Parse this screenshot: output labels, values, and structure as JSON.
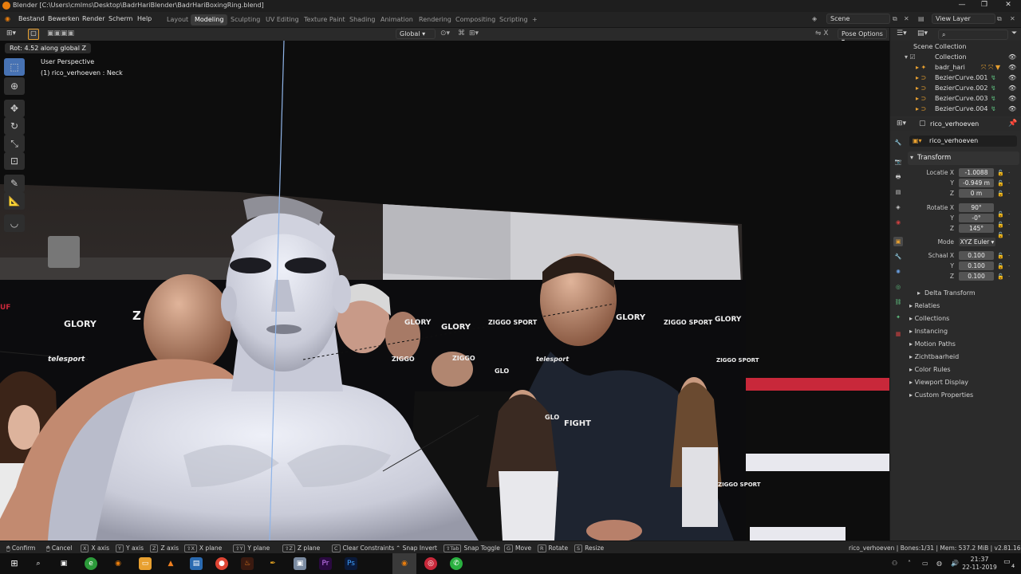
{
  "window": {
    "title": "Blender [C:\\Users\\cmlms\\Desktop\\BadrHariBlender\\BadrHariBoxingRing.blend]"
  },
  "menu": [
    "Bestand",
    "Bewerken",
    "Render",
    "Scherm",
    "Help"
  ],
  "workspaces": [
    "Layout",
    "Modeling",
    "Sculpting",
    "UV Editing",
    "Texture Paint",
    "Shading",
    "Animation",
    "Rendering",
    "Compositing",
    "Scripting",
    "+"
  ],
  "scene": {
    "label": "Scene",
    "view_layer": "View Layer"
  },
  "header3d": {
    "orientation": "Global",
    "pose_options": "Pose Options"
  },
  "viewport": {
    "operator_text": "Rot: 4.52 along global Z",
    "perspective": "User Perspective",
    "object_info": "(1) rico_verhoeven : Neck",
    "backdrop": {
      "logos": [
        "GLORY",
        "GLORY",
        "GLORY",
        "GLORY",
        "GLORY",
        "ZIGGO SPORT",
        "ZIGGO SPORT",
        "ZIGGO SPORT",
        "ZIGGO SPORT",
        "ZIGGO",
        "ZIGGO",
        "telesport",
        "telesport",
        "GLO",
        "GLO",
        "FIGHT",
        "Z",
        "Z",
        "UF"
      ]
    }
  },
  "outliner": {
    "scene_collection": "Scene Collection",
    "collection": "Collection",
    "items": [
      "badr_hari",
      "BezierCurve.001",
      "BezierCurve.002",
      "BezierCurve.003",
      "BezierCurve.004"
    ]
  },
  "properties": {
    "object_name": "rico_verhoeven",
    "data_name": "rico_verhoeven",
    "transform_title": "Transform",
    "location": {
      "label": "Locatie X",
      "x": "-1.0088",
      "y": "-0.949 m",
      "z": "0 m"
    },
    "rotation": {
      "label": "Rotatie X",
      "x": "90°",
      "y": "-0°",
      "z": "145°"
    },
    "mode": {
      "label": "Mode",
      "value": "XYZ Euler"
    },
    "scale": {
      "label": "Schaal X",
      "x": "0.100",
      "y": "0.100",
      "z": "0.100"
    },
    "axis_y": "Y",
    "axis_z": "Z",
    "delta": "Delta Transform",
    "panels": [
      "Relaties",
      "Collections",
      "Instancing",
      "Motion Paths",
      "Zichtbaarheid",
      "Color Rules",
      "Viewport Display",
      "Custom Properties"
    ]
  },
  "status": {
    "hints": [
      {
        "key": "",
        "label": "Confirm"
      },
      {
        "key": "",
        "label": "Cancel"
      },
      {
        "key": "X",
        "label": "X axis"
      },
      {
        "key": "Y",
        "label": "Y axis"
      },
      {
        "key": "Z",
        "label": "Z axis"
      },
      {
        "key": "⇧X",
        "label": "X plane"
      },
      {
        "key": "⇧Y",
        "label": "Y plane"
      },
      {
        "key": "⇧Z",
        "label": "Z plane"
      },
      {
        "key": "C",
        "label": "Clear Constraints"
      },
      {
        "key": "",
        "label": "Snap Invert"
      },
      {
        "key": "⇧Tab",
        "label": "Snap Toggle"
      },
      {
        "key": "G",
        "label": "Move"
      },
      {
        "key": "R",
        "label": "Rotate"
      },
      {
        "key": "S",
        "label": "Resize"
      }
    ],
    "right": "rico_verhoeven | Bones:1/31 | Mem: 537.2 MiB | v2.81.16"
  },
  "taskbar": {
    "time": "21:37",
    "date": "22-11-2019",
    "notifications": "4"
  },
  "colors": {
    "accent": "#4772b3",
    "blender_orange": "#e87d0d",
    "skin": "#d9dbe8",
    "ring_red": "#c8283a"
  }
}
